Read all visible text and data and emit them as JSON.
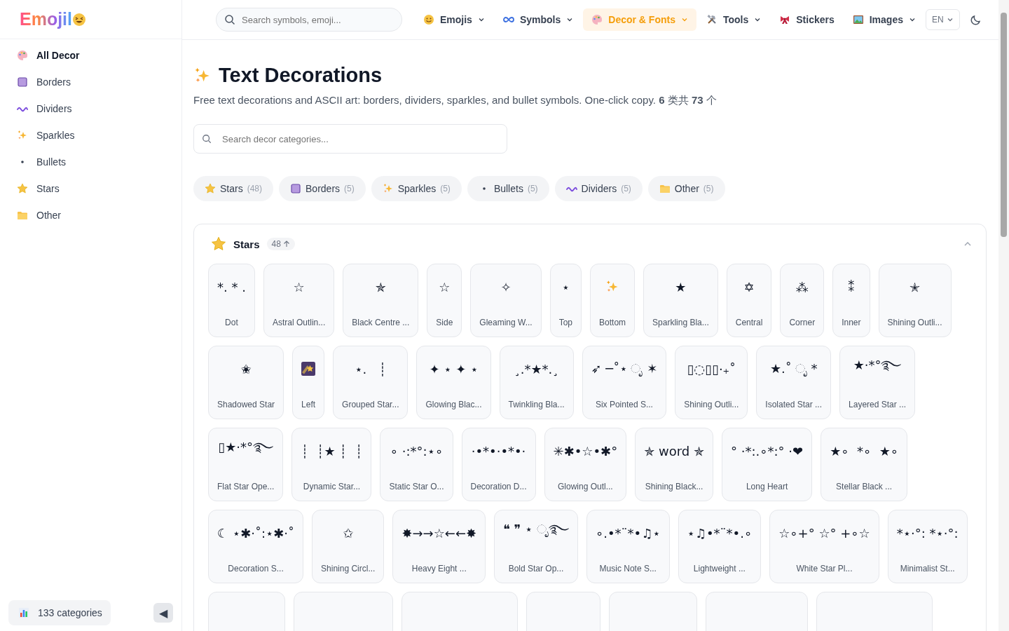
{
  "logo": {
    "text": "Emojil"
  },
  "sidebar": {
    "items": [
      {
        "label": "All Decor",
        "kind": "palette",
        "selected": true
      },
      {
        "label": "Borders",
        "kind": "square",
        "selected": false
      },
      {
        "label": "Dividers",
        "kind": "wave",
        "selected": false
      },
      {
        "label": "Sparkles",
        "kind": "sparkles",
        "selected": false
      },
      {
        "label": "Bullets",
        "kind": "dot",
        "selected": false
      },
      {
        "label": "Stars",
        "kind": "star",
        "selected": false
      },
      {
        "label": "Other",
        "kind": "folder",
        "selected": false
      }
    ],
    "footer": {
      "label": "133 categories",
      "collapse": "◀"
    }
  },
  "header": {
    "search": {
      "placeholder": "Search symbols, emoji..."
    },
    "nav": [
      {
        "label": "Emojis",
        "kind": "smiley",
        "dropdown": true,
        "selected": false
      },
      {
        "label": "Symbols",
        "kind": "infinity",
        "dropdown": true,
        "selected": false
      },
      {
        "label": "Decor & Fonts",
        "kind": "palette",
        "dropdown": true,
        "selected": true
      },
      {
        "label": "Tools",
        "kind": "tools",
        "dropdown": true,
        "selected": false
      },
      {
        "label": "Stickers",
        "kind": "ribbon",
        "dropdown": false,
        "selected": false
      },
      {
        "label": "Images",
        "kind": "image",
        "dropdown": true,
        "selected": false
      }
    ],
    "language": "EN"
  },
  "page": {
    "title": "Text Decorations",
    "subtitle": "Free text decorations and ASCII art: borders, dividers, sparkles, and bullet symbols. One-click copy. **6** 类共 **73** 个",
    "search": {
      "placeholder": "Search decor categories..."
    },
    "chips": [
      {
        "label": "Stars",
        "count": "(48)",
        "kind": "star"
      },
      {
        "label": "Borders",
        "count": "(5)",
        "kind": "square"
      },
      {
        "label": "Sparkles",
        "count": "(5)",
        "kind": "sparkles"
      },
      {
        "label": "Bullets",
        "count": "(5)",
        "kind": "dot"
      },
      {
        "label": "Dividers",
        "count": "(5)",
        "kind": "wave"
      },
      {
        "label": "Other",
        "count": "(5)",
        "kind": "folder"
      }
    ]
  },
  "section": {
    "title": "Stars",
    "count": "48",
    "expanded": true,
    "cards": [
      {
        "kind": "text",
        "symbol": "*. * .",
        "label": "Dot"
      },
      {
        "kind": "text",
        "symbol": "☆",
        "label": "Astral Outlin..."
      },
      {
        "kind": "text",
        "symbol": "✯",
        "label": "Black Centre ..."
      },
      {
        "kind": "text",
        "symbol": "☆",
        "label": "Side"
      },
      {
        "kind": "text",
        "symbol": "✧",
        "label": "Gleaming W..."
      },
      {
        "kind": "text",
        "symbol": "⋆",
        "label": "Top"
      },
      {
        "kind": "sparkles",
        "label": "Bottom"
      },
      {
        "kind": "text",
        "symbol": "★",
        "label": "Sparkling Bla..."
      },
      {
        "kind": "text",
        "symbol": "✡",
        "label": "Central"
      },
      {
        "kind": "text",
        "symbol": "⁂",
        "label": "Corner"
      },
      {
        "kind": "text",
        "symbol": "⁑",
        "label": "Inner"
      },
      {
        "kind": "text",
        "symbol": "✭",
        "label": "Shining Outli..."
      },
      {
        "kind": "text",
        "symbol": "✬",
        "label": "Shadowed Star"
      },
      {
        "kind": "shooting-star",
        "label": "Left"
      },
      {
        "kind": "text",
        "symbol": "⋆.   ┊",
        "label": "Grouped Star..."
      },
      {
        "kind": "text",
        "symbol": "✦ ⋆ ✦ ⋆",
        "label": "Glowing Blac..."
      },
      {
        "kind": "text",
        "symbol": "¸.*★*.¸",
        "label": "Twinkling Bla..."
      },
      {
        "kind": "text",
        "symbol": "➶ ─˚⋆ ೃ ✶",
        "label": "Six Pointed S..."
      },
      {
        "kind": "text",
        "symbol": "▯◌▯▯·₊˚",
        "label": "Shining Outli..."
      },
      {
        "kind": "text",
        "symbol": "★.˚ ೃ *",
        "label": "Isolated Star ..."
      },
      {
        "kind": "text",
        "symbol": "★·*°࿐",
        "label": "Layered Star ..."
      },
      {
        "kind": "text",
        "symbol": "▯★·*°࿐",
        "label": "Flat Star Ope..."
      },
      {
        "kind": "text",
        "symbol": "┊  ┊★ ┊  ┊",
        "label": "Dynamic Star..."
      },
      {
        "kind": "text",
        "symbol": "∘ ·:*°:⋆∘",
        "label": "Static Star O..."
      },
      {
        "kind": "text",
        "symbol": "·•*•·•*•·",
        "label": "Decoration D..."
      },
      {
        "kind": "text",
        "symbol": "✳✱•☆•✱°",
        "label": "Glowing Outl..."
      },
      {
        "kind": "text",
        "symbol": "✯ word ✯",
        "label": "Shining Black..."
      },
      {
        "kind": "text",
        "symbol": "° ·*:.∘*:° ·❤",
        "label": "Long Heart"
      },
      {
        "kind": "text",
        "symbol": "★∘  *∘  ★∘",
        "label": "Stellar Black ..."
      },
      {
        "kind": "text",
        "symbol": "☾ ⋆✱·˚:⋆✱·˚",
        "label": "Decoration S..."
      },
      {
        "kind": "text",
        "symbol": "✩",
        "label": "Shining Circl..."
      },
      {
        "kind": "text",
        "symbol": "✸→→☆←←✸",
        "label": "Heavy Eight ..."
      },
      {
        "kind": "text",
        "symbol": "❝ ❞ ⋆ ◌ೃ࿐",
        "label": "Bold Star Op..."
      },
      {
        "kind": "text",
        "symbol": "∘.•*¨*•♫⋆",
        "label": "Music Note S..."
      },
      {
        "kind": "text",
        "symbol": "⋆♫•*¨*•.∘",
        "label": "Lightweight ..."
      },
      {
        "kind": "text",
        "symbol": "☆∘+° ☆° +∘☆",
        "label": "White Star Pl..."
      },
      {
        "kind": "text",
        "symbol": "*⋆·°: *⋆·°:",
        "label": "Minimalist St..."
      },
      {
        "kind": "cut"
      },
      {
        "kind": "cut"
      },
      {
        "kind": "cut"
      },
      {
        "kind": "cut"
      },
      {
        "kind": "cut"
      },
      {
        "kind": "cut"
      },
      {
        "kind": "cut"
      }
    ]
  }
}
